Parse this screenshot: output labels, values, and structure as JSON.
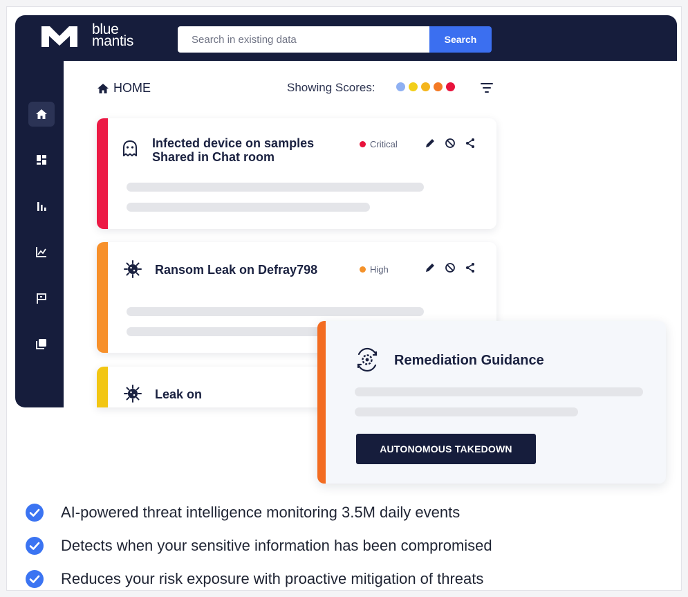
{
  "brand": {
    "name_line1": "blue",
    "name_line2": "mantis"
  },
  "search": {
    "placeholder": "Search in existing data",
    "button_label": "Search"
  },
  "sidebar": {
    "items": [
      {
        "icon": "home-icon",
        "active": true
      },
      {
        "icon": "dashboard-icon",
        "active": false
      },
      {
        "icon": "bar-chart-icon",
        "active": false
      },
      {
        "icon": "line-chart-icon",
        "active": false
      },
      {
        "icon": "flag-icon",
        "active": false
      },
      {
        "icon": "copy-icon",
        "active": false
      }
    ]
  },
  "header": {
    "breadcrumb": "HOME",
    "scores_label": "Showing Scores:",
    "score_colors": [
      "#8fb0f2",
      "#f2cf1a",
      "#f4b51c",
      "#f47a25",
      "#e8123c"
    ]
  },
  "alerts": [
    {
      "title_line1": "Infected device on samples",
      "title_line2": "Shared in Chat room",
      "severity": "Critical",
      "severity_color": "#e8123c",
      "stripe_color": "#ec1a45",
      "icon": "ghost-icon"
    },
    {
      "title_line1": "Ransom Leak on Defray798",
      "severity": "High",
      "severity_color": "#f4922b",
      "stripe_color": "#f7902a",
      "icon": "virus-icon"
    },
    {
      "title_line1": "Leak on",
      "stripe_color": "#f2c613",
      "icon": "virus-icon"
    }
  ],
  "remediation": {
    "title": "Remediation Guidance",
    "button_label": "AUTONOMOUS TAKEDOWN",
    "icon": "gear-refresh-icon"
  },
  "benefits": [
    "AI-powered threat intelligence monitoring 3.5M daily events",
    "Detects when your sensitive information has been compromised",
    "Reduces your risk exposure with proactive mitigation of threats"
  ],
  "colors": {
    "navy": "#161d3c",
    "accent_blue": "#3b6ff0",
    "orange": "#f36c21",
    "check_blue": "#3b74f2"
  }
}
